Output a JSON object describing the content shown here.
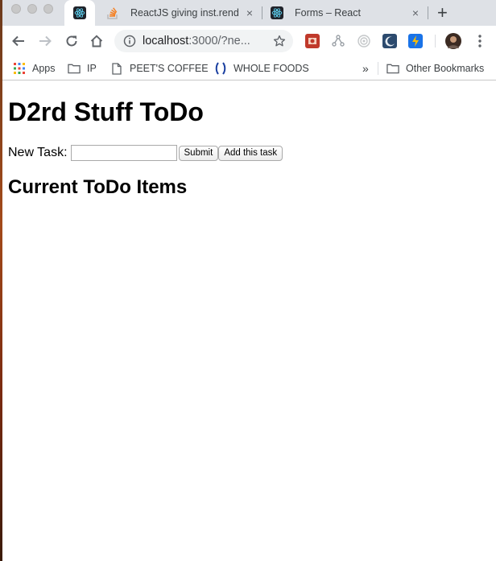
{
  "browser": {
    "tabs": [
      {
        "title": "",
        "favicon": "react-icon",
        "active": true
      },
      {
        "title": "ReactJS giving inst.rend",
        "favicon": "stackoverflow-icon",
        "close": "×"
      },
      {
        "title": "Forms – React",
        "favicon": "react-icon",
        "close": "×"
      }
    ],
    "new_tab": "+",
    "address": {
      "host": "localhost",
      "rest": ":3000/?ne..."
    },
    "bookmarks": [
      {
        "label": "Apps",
        "icon": "apps-grid-icon"
      },
      {
        "label": "IP",
        "icon": "folder-icon"
      },
      {
        "label": "PEET'S COFFEE",
        "icon": "page-icon"
      },
      {
        "label": "WHOLE FOODS",
        "icon": "wholefoods-icon"
      }
    ],
    "overflow": "»",
    "other_bookmarks": "Other Bookmarks",
    "colors": {
      "tabstrip": "#dee1e6",
      "omnibox": "#f1f3f4",
      "react": "#61dafb"
    }
  },
  "page": {
    "heading": "D2rd Stuff ToDo",
    "new_task_label": "New Task:",
    "new_task_value": "",
    "submit_label": "Submit",
    "add_label": "Add this task",
    "list_heading": "Current ToDo Items"
  }
}
